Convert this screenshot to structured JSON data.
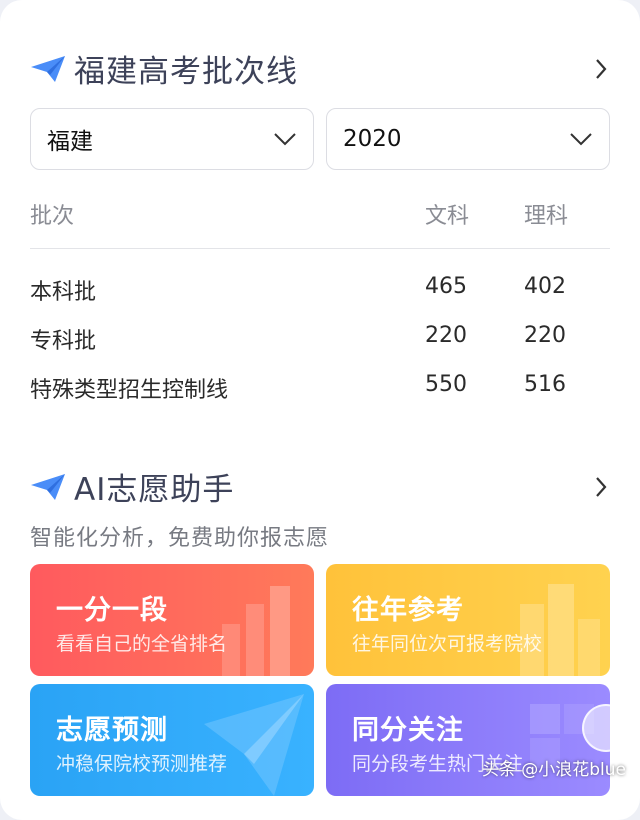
{
  "section1": {
    "title": "福建高考批次线"
  },
  "filters": {
    "province": "福建",
    "year": "2020"
  },
  "table": {
    "headers": [
      "批次",
      "文科",
      "理科"
    ],
    "rows": [
      {
        "batch": "本科批",
        "wenke": "465",
        "like": "402"
      },
      {
        "batch": "专科批",
        "wenke": "220",
        "like": "220"
      },
      {
        "batch": "特殊类型招生控制线",
        "wenke": "550",
        "like": "516"
      }
    ]
  },
  "section2": {
    "title": "AI志愿助手",
    "subtitle": "智能化分析，免费助你报志愿"
  },
  "tiles": [
    {
      "title": "一分一段",
      "sub": "看看自己的全省排名"
    },
    {
      "title": "往年参考",
      "sub": "往年同位次可报考院校"
    },
    {
      "title": "志愿预测",
      "sub": "冲稳保院校预测推荐"
    },
    {
      "title": "同分关注",
      "sub": "同分段考生热门关注"
    }
  ],
  "watermark": "头条 @小浪花blue",
  "colors": {
    "accent": "#4a8df8",
    "red": "#ff5a5e",
    "yellow": "#ffc23a",
    "blue": "#2aa3f5",
    "purple": "#7d6cf5"
  }
}
